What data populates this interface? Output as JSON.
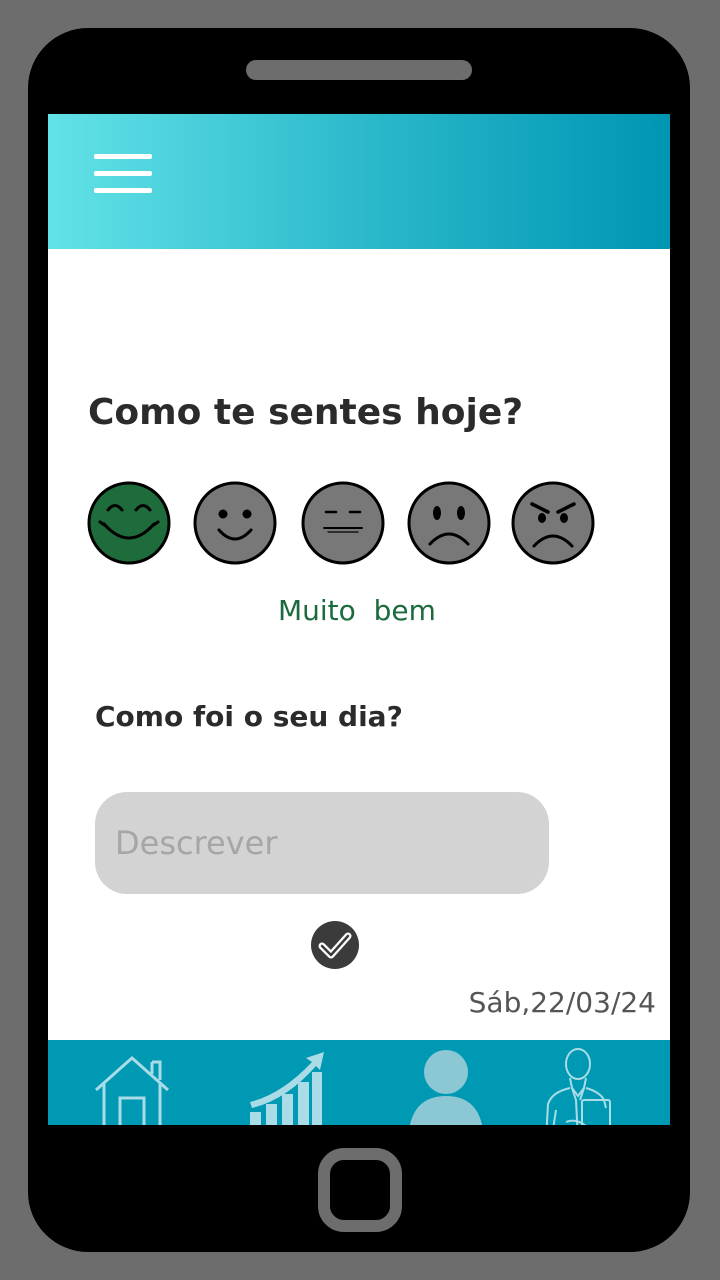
{
  "header": {
    "menu_icon": "hamburger-menu-icon"
  },
  "mood_question": "Como te sentes hoje?",
  "moods": {
    "selected_color": "#1e6b3b",
    "default_color": "#787878",
    "selected_label": "Muito  bem",
    "items": [
      {
        "icon": "very-happy-face-icon",
        "selected": true
      },
      {
        "icon": "happy-face-icon",
        "selected": false
      },
      {
        "icon": "neutral-face-icon",
        "selected": false
      },
      {
        "icon": "sad-face-icon",
        "selected": false
      },
      {
        "icon": "angry-face-icon",
        "selected": false
      }
    ]
  },
  "day_question": "Como foi o seu dia?",
  "description": {
    "value": "",
    "placeholder": "Descrever"
  },
  "confirm_icon": "check-circle-icon",
  "date": "Sáb,22/03/24",
  "nav": {
    "background": "#0099b4",
    "items": [
      {
        "icon": "home-icon",
        "active": false
      },
      {
        "icon": "progress-chart-icon",
        "active": false
      },
      {
        "icon": "profile-icon",
        "active": true
      },
      {
        "icon": "doctor-icon",
        "active": false
      }
    ]
  }
}
